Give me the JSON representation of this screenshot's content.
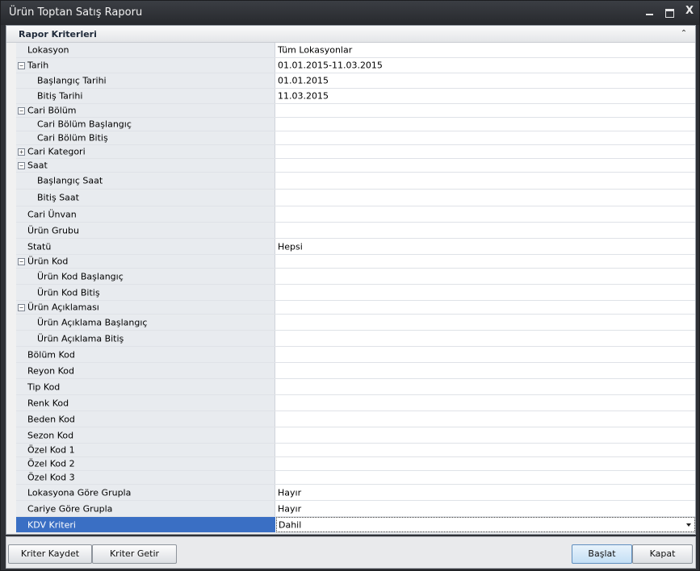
{
  "window": {
    "title": "Ürün Toptan Satış Raporu",
    "close_glyph": "X"
  },
  "group": {
    "title": "Rapor Kriterleri",
    "collapse_glyph": "⌃"
  },
  "rows": [
    {
      "label": "Lokasyon",
      "value": "Tüm Lokasyonlar",
      "level": 1,
      "expander": ""
    },
    {
      "label": "Tarih",
      "value": "01.01.2015-11.03.2015",
      "level": 1,
      "expander": "−"
    },
    {
      "label": "Başlangıç Tarihi",
      "value": "01.01.2015",
      "level": 2,
      "expander": ""
    },
    {
      "label": "Bitiş Tarihi",
      "value": "11.03.2015",
      "level": 2,
      "expander": ""
    },
    {
      "label": "Cari Bölüm",
      "value": "",
      "level": 1,
      "expander": "−"
    },
    {
      "label": "Cari Bölüm Başlangıç",
      "value": "",
      "level": 2,
      "expander": ""
    },
    {
      "label": "Cari Bölüm Bitiş",
      "value": "",
      "level": 2,
      "expander": ""
    },
    {
      "label": "Cari Kategori",
      "value": "",
      "level": 1,
      "expander": "+"
    },
    {
      "label": "Saat",
      "value": "",
      "level": 1,
      "expander": "−"
    },
    {
      "label": "Başlangıç Saat",
      "value": "",
      "level": 2,
      "expander": ""
    },
    {
      "label": "Bitiş Saat",
      "value": "",
      "level": 2,
      "expander": ""
    },
    {
      "label": "Cari Ünvan",
      "value": "",
      "level": 1,
      "expander": ""
    },
    {
      "label": "Ürün Grubu",
      "value": "",
      "level": 1,
      "expander": ""
    },
    {
      "label": "Statü",
      "value": "Hepsi",
      "level": 1,
      "expander": ""
    },
    {
      "label": "Ürün Kod",
      "value": "",
      "level": 1,
      "expander": "−"
    },
    {
      "label": "Ürün Kod Başlangıç",
      "value": "",
      "level": 2,
      "expander": ""
    },
    {
      "label": "Ürün Kod Bitiş",
      "value": "",
      "level": 2,
      "expander": ""
    },
    {
      "label": "Ürün Açıklaması",
      "value": "",
      "level": 1,
      "expander": "−"
    },
    {
      "label": "Ürün Açıklama Başlangıç",
      "value": "",
      "level": 2,
      "expander": ""
    },
    {
      "label": "Ürün Açıklama Bitiş",
      "value": "",
      "level": 2,
      "expander": ""
    },
    {
      "label": "Bölüm Kod",
      "value": "",
      "level": 1,
      "expander": ""
    },
    {
      "label": "Reyon Kod",
      "value": "",
      "level": 1,
      "expander": ""
    },
    {
      "label": "Tip Kod",
      "value": "",
      "level": 1,
      "expander": ""
    },
    {
      "label": "Renk Kod",
      "value": "",
      "level": 1,
      "expander": ""
    },
    {
      "label": "Beden Kod",
      "value": "",
      "level": 1,
      "expander": ""
    },
    {
      "label": "Sezon Kod",
      "value": "",
      "level": 1,
      "expander": ""
    },
    {
      "label": "Özel Kod 1",
      "value": "",
      "level": 1,
      "expander": ""
    },
    {
      "label": "Özel Kod 2",
      "value": "",
      "level": 1,
      "expander": ""
    },
    {
      "label": "Özel Kod 3",
      "value": "",
      "level": 1,
      "expander": ""
    },
    {
      "label": "Lokasyona Göre Grupla",
      "value": "Hayır",
      "level": 1,
      "expander": ""
    },
    {
      "label": "Cariye Göre Grupla",
      "value": "Hayır",
      "level": 1,
      "expander": ""
    },
    {
      "label": "KDV Kriteri",
      "value": "Dahil",
      "level": 1,
      "expander": "",
      "selected": true,
      "dropdown": true
    }
  ],
  "footer": {
    "save_criteria": "Kriter Kaydet",
    "load_criteria": "Kriter Getir",
    "start": "Başlat",
    "close": "Kapat"
  },
  "colors": {
    "selected_row": "#3a6fc4",
    "label_column": "#e8ebef"
  }
}
